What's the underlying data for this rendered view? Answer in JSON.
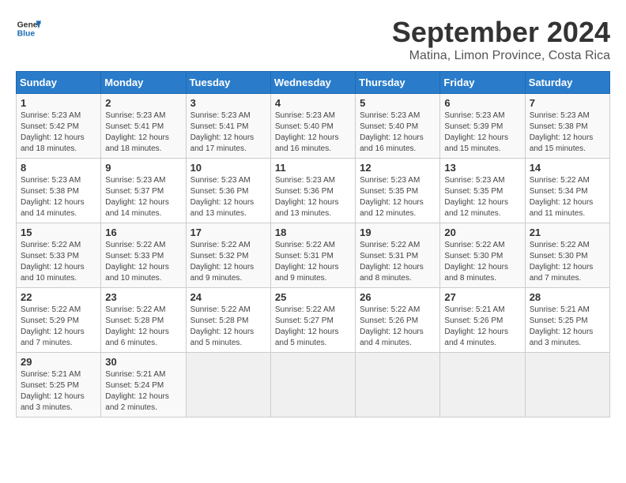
{
  "header": {
    "logo_line1": "General",
    "logo_line2": "Blue",
    "month": "September 2024",
    "location": "Matina, Limon Province, Costa Rica"
  },
  "weekdays": [
    "Sunday",
    "Monday",
    "Tuesday",
    "Wednesday",
    "Thursday",
    "Friday",
    "Saturday"
  ],
  "weeks": [
    [
      {
        "day": "1",
        "sunrise": "Sunrise: 5:23 AM",
        "sunset": "Sunset: 5:42 PM",
        "daylight": "Daylight: 12 hours and 18 minutes."
      },
      {
        "day": "2",
        "sunrise": "Sunrise: 5:23 AM",
        "sunset": "Sunset: 5:41 PM",
        "daylight": "Daylight: 12 hours and 18 minutes."
      },
      {
        "day": "3",
        "sunrise": "Sunrise: 5:23 AM",
        "sunset": "Sunset: 5:41 PM",
        "daylight": "Daylight: 12 hours and 17 minutes."
      },
      {
        "day": "4",
        "sunrise": "Sunrise: 5:23 AM",
        "sunset": "Sunset: 5:40 PM",
        "daylight": "Daylight: 12 hours and 16 minutes."
      },
      {
        "day": "5",
        "sunrise": "Sunrise: 5:23 AM",
        "sunset": "Sunset: 5:40 PM",
        "daylight": "Daylight: 12 hours and 16 minutes."
      },
      {
        "day": "6",
        "sunrise": "Sunrise: 5:23 AM",
        "sunset": "Sunset: 5:39 PM",
        "daylight": "Daylight: 12 hours and 15 minutes."
      },
      {
        "day": "7",
        "sunrise": "Sunrise: 5:23 AM",
        "sunset": "Sunset: 5:38 PM",
        "daylight": "Daylight: 12 hours and 15 minutes."
      }
    ],
    [
      {
        "day": "8",
        "sunrise": "Sunrise: 5:23 AM",
        "sunset": "Sunset: 5:38 PM",
        "daylight": "Daylight: 12 hours and 14 minutes."
      },
      {
        "day": "9",
        "sunrise": "Sunrise: 5:23 AM",
        "sunset": "Sunset: 5:37 PM",
        "daylight": "Daylight: 12 hours and 14 minutes."
      },
      {
        "day": "10",
        "sunrise": "Sunrise: 5:23 AM",
        "sunset": "Sunset: 5:36 PM",
        "daylight": "Daylight: 12 hours and 13 minutes."
      },
      {
        "day": "11",
        "sunrise": "Sunrise: 5:23 AM",
        "sunset": "Sunset: 5:36 PM",
        "daylight": "Daylight: 12 hours and 13 minutes."
      },
      {
        "day": "12",
        "sunrise": "Sunrise: 5:23 AM",
        "sunset": "Sunset: 5:35 PM",
        "daylight": "Daylight: 12 hours and 12 minutes."
      },
      {
        "day": "13",
        "sunrise": "Sunrise: 5:23 AM",
        "sunset": "Sunset: 5:35 PM",
        "daylight": "Daylight: 12 hours and 12 minutes."
      },
      {
        "day": "14",
        "sunrise": "Sunrise: 5:22 AM",
        "sunset": "Sunset: 5:34 PM",
        "daylight": "Daylight: 12 hours and 11 minutes."
      }
    ],
    [
      {
        "day": "15",
        "sunrise": "Sunrise: 5:22 AM",
        "sunset": "Sunset: 5:33 PM",
        "daylight": "Daylight: 12 hours and 10 minutes."
      },
      {
        "day": "16",
        "sunrise": "Sunrise: 5:22 AM",
        "sunset": "Sunset: 5:33 PM",
        "daylight": "Daylight: 12 hours and 10 minutes."
      },
      {
        "day": "17",
        "sunrise": "Sunrise: 5:22 AM",
        "sunset": "Sunset: 5:32 PM",
        "daylight": "Daylight: 12 hours and 9 minutes."
      },
      {
        "day": "18",
        "sunrise": "Sunrise: 5:22 AM",
        "sunset": "Sunset: 5:31 PM",
        "daylight": "Daylight: 12 hours and 9 minutes."
      },
      {
        "day": "19",
        "sunrise": "Sunrise: 5:22 AM",
        "sunset": "Sunset: 5:31 PM",
        "daylight": "Daylight: 12 hours and 8 minutes."
      },
      {
        "day": "20",
        "sunrise": "Sunrise: 5:22 AM",
        "sunset": "Sunset: 5:30 PM",
        "daylight": "Daylight: 12 hours and 8 minutes."
      },
      {
        "day": "21",
        "sunrise": "Sunrise: 5:22 AM",
        "sunset": "Sunset: 5:30 PM",
        "daylight": "Daylight: 12 hours and 7 minutes."
      }
    ],
    [
      {
        "day": "22",
        "sunrise": "Sunrise: 5:22 AM",
        "sunset": "Sunset: 5:29 PM",
        "daylight": "Daylight: 12 hours and 7 minutes."
      },
      {
        "day": "23",
        "sunrise": "Sunrise: 5:22 AM",
        "sunset": "Sunset: 5:28 PM",
        "daylight": "Daylight: 12 hours and 6 minutes."
      },
      {
        "day": "24",
        "sunrise": "Sunrise: 5:22 AM",
        "sunset": "Sunset: 5:28 PM",
        "daylight": "Daylight: 12 hours and 5 minutes."
      },
      {
        "day": "25",
        "sunrise": "Sunrise: 5:22 AM",
        "sunset": "Sunset: 5:27 PM",
        "daylight": "Daylight: 12 hours and 5 minutes."
      },
      {
        "day": "26",
        "sunrise": "Sunrise: 5:22 AM",
        "sunset": "Sunset: 5:26 PM",
        "daylight": "Daylight: 12 hours and 4 minutes."
      },
      {
        "day": "27",
        "sunrise": "Sunrise: 5:21 AM",
        "sunset": "Sunset: 5:26 PM",
        "daylight": "Daylight: 12 hours and 4 minutes."
      },
      {
        "day": "28",
        "sunrise": "Sunrise: 5:21 AM",
        "sunset": "Sunset: 5:25 PM",
        "daylight": "Daylight: 12 hours and 3 minutes."
      }
    ],
    [
      {
        "day": "29",
        "sunrise": "Sunrise: 5:21 AM",
        "sunset": "Sunset: 5:25 PM",
        "daylight": "Daylight: 12 hours and 3 minutes."
      },
      {
        "day": "30",
        "sunrise": "Sunrise: 5:21 AM",
        "sunset": "Sunset: 5:24 PM",
        "daylight": "Daylight: 12 hours and 2 minutes."
      },
      null,
      null,
      null,
      null,
      null
    ]
  ]
}
